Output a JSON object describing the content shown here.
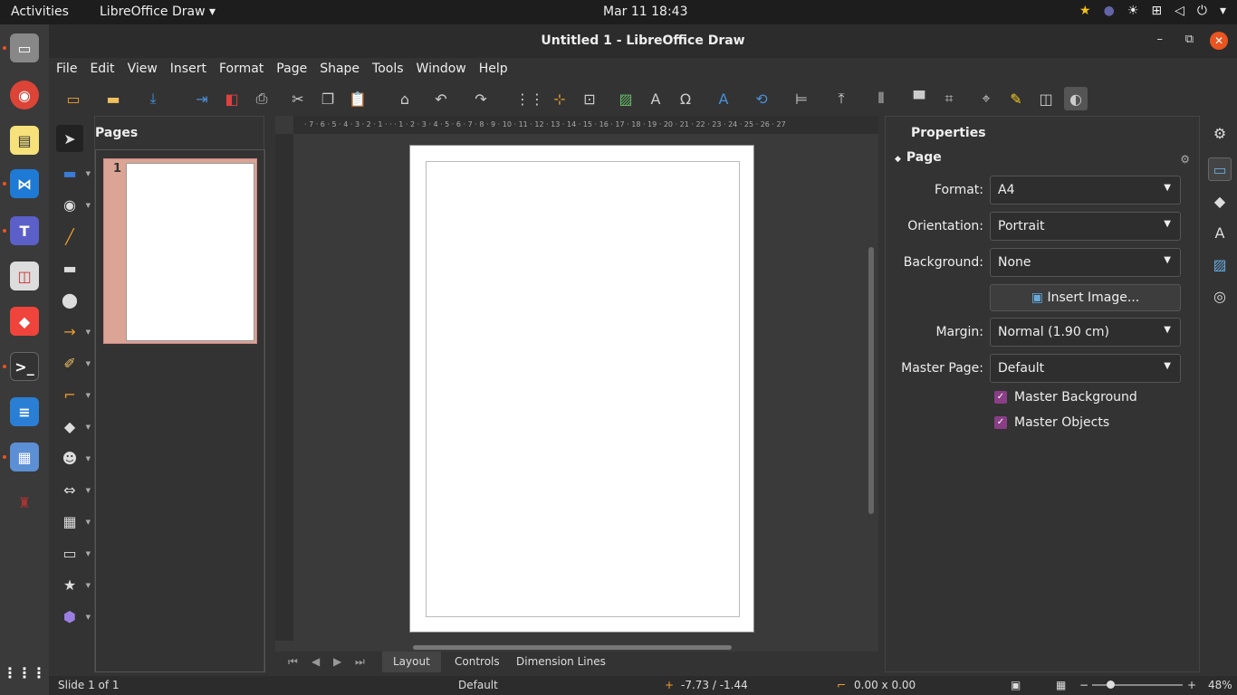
{
  "topbar": {
    "activities": "Activities",
    "app_menu": "LibreOffice Draw ▾",
    "clock": "Mar 11  18:43",
    "tray_icons": [
      "star-icon",
      "teams-icon",
      "brightness-icon",
      "network-icon",
      "volume-icon",
      "power-icon",
      "chevron-down-icon"
    ]
  },
  "dock": {
    "items": [
      "files",
      "chrome",
      "notes",
      "vscode",
      "teams",
      "reader",
      "anydesk",
      "terminal",
      "writer",
      "remote-desktop",
      "wine",
      "app-grid"
    ]
  },
  "window": {
    "title": "Untitled 1 - LibreOffice Draw",
    "minimize": "–",
    "maximize": "⧉",
    "close": "✕"
  },
  "menu": [
    "File",
    "Edit",
    "View",
    "Insert",
    "Format",
    "Page",
    "Shape",
    "Tools",
    "Window",
    "Help"
  ],
  "pages_panel": {
    "title": "Pages",
    "page_number": "1"
  },
  "ruler": {
    "h_labels": "· 7 · 6 · 5 · 4 · 3 · 2 · 1 · · · 1 · 2 · 3 · 4 · 5 · 6 · 7 · 8 · 9 · 10 · 11 · 12 · 13 · 14 · 15 · 16 · 17 · 18 · 19 · 20 · 21 · 22 · 23 · 24 · 25 · 26 · 27"
  },
  "tabs": {
    "items": [
      "Layout",
      "Controls",
      "Dimension Lines"
    ],
    "selected": "Layout"
  },
  "properties": {
    "title": "Properties",
    "section": "Page",
    "format_label": "Format:",
    "format_value": "A4",
    "orientation_label": "Orientation:",
    "orientation_value": "Portrait",
    "background_label": "Background:",
    "background_value": "None",
    "insert_image": "Insert Image...",
    "margin_label": "Margin:",
    "margin_value": "Normal (1.90 cm)",
    "master_page_label": "Master Page:",
    "master_page_value": "Default",
    "master_background": "Master Background",
    "master_objects": "Master Objects"
  },
  "status": {
    "slide": "Slide 1 of 1",
    "master": "Default",
    "position": "-7.73 / -1.44",
    "size": "0.00 x 0.00",
    "zoom": "48%"
  },
  "colors": {
    "accent": "#e95420",
    "checkbox": "#8a3e86",
    "page_thumb_bg": "#dba494"
  }
}
